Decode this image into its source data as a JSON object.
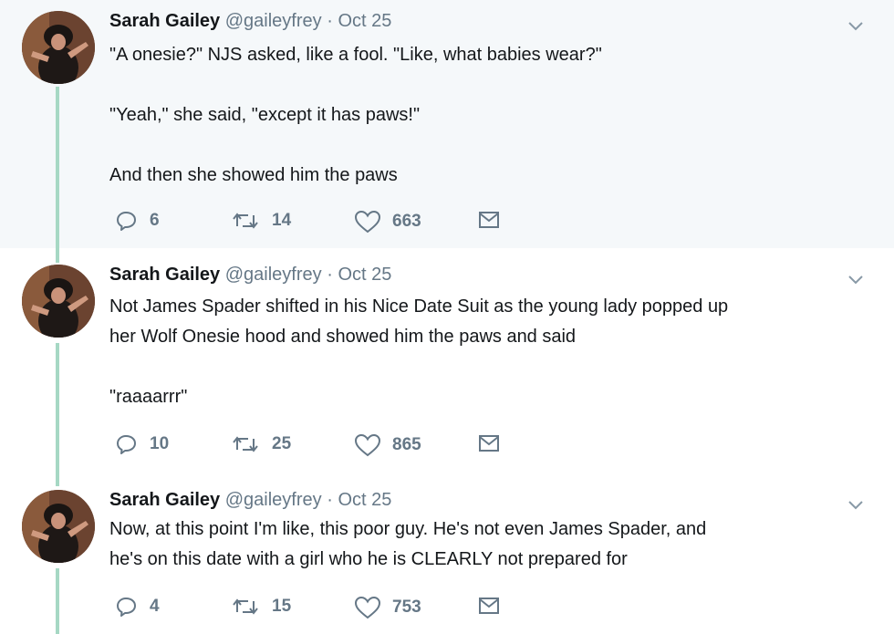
{
  "tweets": [
    {
      "name": "Sarah Gailey",
      "handle": "@gaileyfrey",
      "sep": "·",
      "date": "Oct 25",
      "lines": [
        "\"A onesie?\" NJS asked, like a fool. \"Like, what babies wear?\"",
        "",
        "\"Yeah,\" she said, \"except it has paws!\"",
        "",
        "And then she showed him the paws"
      ],
      "replies": "6",
      "retweets": "14",
      "likes": "663"
    },
    {
      "name": "Sarah Gailey",
      "handle": "@gaileyfrey",
      "sep": "·",
      "date": "Oct 25",
      "lines": [
        "Not James Spader shifted in his Nice Date Suit as the young lady popped up",
        "her Wolf Onesie hood and showed him the paws and said",
        "",
        "\"raaaarrr\""
      ],
      "replies": "10",
      "retweets": "25",
      "likes": "865"
    },
    {
      "name": "Sarah Gailey",
      "handle": "@gaileyfrey",
      "sep": "·",
      "date": "Oct 25",
      "lines": [
        "Now, at this point I'm like, this poor guy. He's not even James Spader, and",
        "he's on this date with a girl who he is CLEARLY not prepared for"
      ],
      "replies": "4",
      "retweets": "15",
      "likes": "753"
    }
  ],
  "icons": {
    "reply": "reply-icon",
    "retweet": "retweet-icon",
    "like": "heart-icon",
    "message": "envelope-icon",
    "more": "chevron-down-icon"
  },
  "colors": {
    "thread_line": "#a6d8c4",
    "highlight_bg": "#f5f8fa",
    "meta_text": "#657786"
  }
}
